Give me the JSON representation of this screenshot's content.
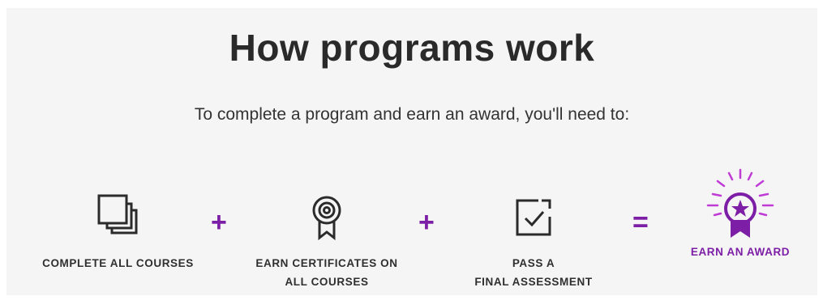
{
  "header": {
    "title": "How programs work",
    "subtitle": "To complete a program and earn an award, you'll need to:"
  },
  "steps": [
    {
      "icon": "stacked-pages-icon",
      "label": "COMPLETE ALL COURSES"
    },
    {
      "icon": "certificate-ribbon-icon",
      "label": "EARN CERTIFICATES ON\nALL COURSES"
    },
    {
      "icon": "checkbox-icon",
      "label": "PASS A\nFINAL ASSESSMENT"
    },
    {
      "icon": "award-star-icon",
      "label": "EARN AN AWARD"
    }
  ],
  "operators": {
    "plus": "+",
    "equals": "="
  },
  "colors": {
    "accent": "#7d1fa6",
    "text": "#2b2b2b",
    "background": "#f5f5f5"
  }
}
